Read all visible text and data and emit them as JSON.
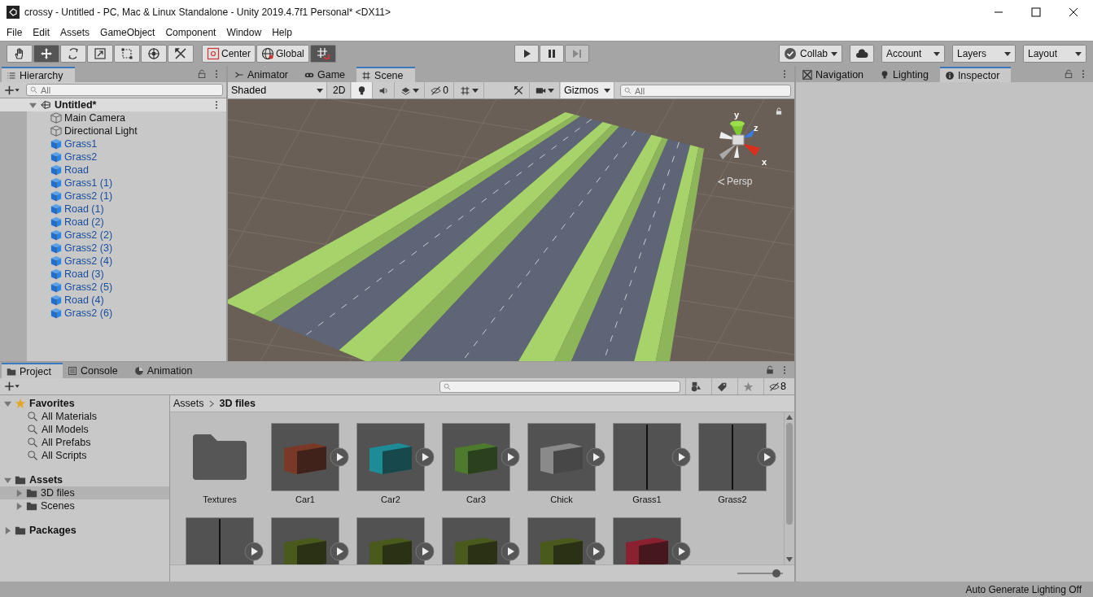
{
  "window": {
    "title": "crossy - Untitled - PC, Mac & Linux Standalone - Unity 2019.4.7f1 Personal* <DX11>"
  },
  "menu": [
    "File",
    "Edit",
    "Assets",
    "GameObject",
    "Component",
    "Window",
    "Help"
  ],
  "toolbar": {
    "tools": [
      {
        "kind": "hand",
        "selected": false
      },
      {
        "kind": "move",
        "selected": true
      },
      {
        "kind": "rotate",
        "selected": false
      },
      {
        "kind": "scale",
        "selected": false
      },
      {
        "kind": "rect",
        "selected": false
      },
      {
        "kind": "transform",
        "selected": false
      },
      {
        "kind": "custom",
        "selected": false
      }
    ],
    "pivot": "Center",
    "space": "Global",
    "snap": {
      "on": true
    },
    "playback": [
      {
        "kind": "play",
        "disabled": false
      },
      {
        "kind": "pause",
        "disabled": false
      },
      {
        "kind": "step",
        "disabled": true
      }
    ],
    "collab": "Collab",
    "dropdowns": [
      "Account",
      "Layers",
      "Layout"
    ]
  },
  "hierarchy": {
    "tab": "Hierarchy",
    "search": {
      "placeholder": "All"
    },
    "scene": {
      "name": "Untitled*",
      "expanded": true,
      "children": [
        {
          "name": "Main Camera",
          "kind": "object"
        },
        {
          "name": "Directional Light",
          "kind": "object"
        },
        {
          "name": "Grass1",
          "kind": "prefab"
        },
        {
          "name": "Grass2",
          "kind": "prefab"
        },
        {
          "name": "Road",
          "kind": "prefab"
        },
        {
          "name": "Grass1 (1)",
          "kind": "prefab"
        },
        {
          "name": "Grass2 (1)",
          "kind": "prefab"
        },
        {
          "name": "Road (1)",
          "kind": "prefab"
        },
        {
          "name": "Road (2)",
          "kind": "prefab"
        },
        {
          "name": "Grass2 (2)",
          "kind": "prefab"
        },
        {
          "name": "Grass2 (3)",
          "kind": "prefab"
        },
        {
          "name": "Grass2 (4)",
          "kind": "prefab"
        },
        {
          "name": "Road (3)",
          "kind": "prefab"
        },
        {
          "name": "Grass2 (5)",
          "kind": "prefab"
        },
        {
          "name": "Road (4)",
          "kind": "prefab"
        },
        {
          "name": "Grass2 (6)",
          "kind": "prefab"
        }
      ]
    }
  },
  "scene_panel": {
    "tabs": [
      {
        "label": "Animator",
        "kind": "animator",
        "selected": false
      },
      {
        "label": "Game",
        "kind": "game",
        "selected": false
      },
      {
        "label": "Scene",
        "kind": "scene",
        "selected": true
      }
    ],
    "shading": "Shaded",
    "mode_2d": {
      "label": "2D",
      "on": false
    },
    "lighting": {
      "on": true
    },
    "audio": {
      "on": false
    },
    "hidden_count": "0",
    "gizmos": "Gizmos",
    "search": {
      "placeholder": "All"
    },
    "gizmo": {
      "axes": [
        "y",
        "z",
        "x"
      ],
      "projection": "Persp"
    }
  },
  "inspector_panel": {
    "tabs": [
      {
        "label": "Navigation",
        "kind": "navigation",
        "selected": false
      },
      {
        "label": "Lighting",
        "kind": "lighting",
        "selected": false
      },
      {
        "label": "Inspector",
        "kind": "inspector",
        "selected": true
      }
    ]
  },
  "project": {
    "tabs": [
      {
        "label": "Project",
        "kind": "project",
        "selected": true
      },
      {
        "label": "Console",
        "kind": "console",
        "selected": false
      },
      {
        "label": "Animation",
        "kind": "animation",
        "selected": false
      }
    ],
    "hidden_count": "8",
    "tree": [
      {
        "name": "Favorites",
        "kind": "favorites",
        "expanded": true,
        "selected": false,
        "children": [
          {
            "name": "All Materials",
            "kind": "search",
            "selected": false
          },
          {
            "name": "All Models",
            "kind": "search",
            "selected": false
          },
          {
            "name": "All Prefabs",
            "kind": "search",
            "selected": false
          },
          {
            "name": "All Scripts",
            "kind": "search",
            "selected": false
          }
        ]
      },
      {
        "name": "Assets",
        "kind": "folder",
        "expanded": true,
        "selected": false,
        "children": [
          {
            "name": "3D files",
            "kind": "folder",
            "expanded": false,
            "selected": true
          },
          {
            "name": "Scenes",
            "kind": "folder",
            "expanded": false,
            "selected": false
          }
        ]
      },
      {
        "name": "Packages",
        "kind": "folder",
        "expanded": false,
        "selected": false
      }
    ],
    "breadcrumb": [
      "Assets",
      "3D files"
    ],
    "assets": [
      {
        "name": "Textures",
        "kind": "folder"
      },
      {
        "name": "Car1",
        "kind": "box_model",
        "color": "#7a3826"
      },
      {
        "name": "Car2",
        "kind": "box_model",
        "color": "#1d8c96"
      },
      {
        "name": "Car3",
        "kind": "box_model",
        "color": "#4d7a2c"
      },
      {
        "name": "Chick",
        "kind": "box_model",
        "color": "#8a8a8a"
      },
      {
        "name": "Grass1",
        "kind": "strip_model"
      },
      {
        "name": "Grass2",
        "kind": "strip_model"
      },
      {
        "kind": "strip_model"
      },
      {
        "kind": "box_model",
        "color": "#4a5a1c"
      },
      {
        "kind": "box_model",
        "color": "#4a5a1c"
      },
      {
        "kind": "box_model",
        "color": "#4a5a1c"
      },
      {
        "kind": "box_model",
        "color": "#4a5a1c"
      },
      {
        "kind": "box_model",
        "color": "#8a2030"
      }
    ],
    "zoom": {
      "level": 0.85
    }
  },
  "status_bar": "Auto Generate Lighting Off"
}
